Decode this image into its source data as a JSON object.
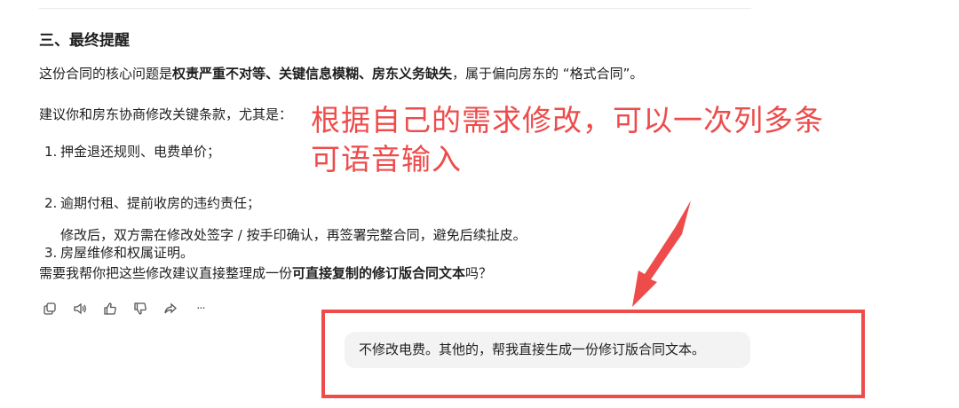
{
  "message": {
    "heading": "三、最终提醒",
    "para1": {
      "prefix": "这份合同的核心问题是",
      "bold": "权责严重不对等、关键信息模糊、房东义务缺失",
      "suffix": "，属于偏向房东的 “格式合同”。"
    },
    "para2": "建议你和房东协商修改关键条款，尤其是：",
    "list": [
      {
        "num": "1.",
        "text": "押金退还规则、电费单价；"
      },
      {
        "num": "2.",
        "text": "逾期付租、提前收房的违约责任；"
      },
      {
        "num": "3.",
        "text": "房屋维修和权属证明。"
      }
    ],
    "list_continuation": "修改后，双方需在修改处签字 / 按手印确认，再签署完整合同，避免后续扯皮。",
    "para3": {
      "prefix": "需要我帮你把这些修改建议直接整理成一份",
      "bold": "可直接复制的修订版合同文本",
      "suffix": "吗？"
    }
  },
  "actions": {
    "icons": [
      "copy-icon",
      "speaker-icon",
      "thumbs-up-icon",
      "thumbs-down-icon",
      "share-icon",
      "more-icon"
    ],
    "more_label": "···"
  },
  "annotation": {
    "line1": "根据自己的需求修改，可以一次列多条",
    "line2": "可语音输入",
    "color": "#ee4b4b"
  },
  "user_input": {
    "text": "不修改电费。其他的，帮我直接生成一份修订版合同文本。"
  }
}
